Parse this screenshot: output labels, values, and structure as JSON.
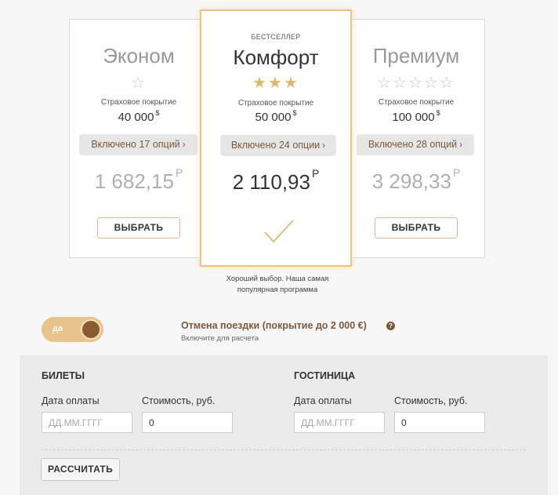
{
  "plans": [
    {
      "name": "Эконом",
      "stars": "☆",
      "coverage_label": "Страховое покрытие",
      "coverage_value": "40 000",
      "coverage_currency": "$",
      "options": "Включено 17 опций",
      "price": "1 682,15",
      "price_currency": "Р",
      "button": "ВЫБРАТЬ",
      "rating": 1,
      "rating_max": 1
    },
    {
      "name": "Комфорт",
      "badge": "БЕСТСЕЛЛЕР",
      "stars": "★★★",
      "coverage_label": "Страховое покрытие",
      "coverage_value": "50 000",
      "coverage_currency": "$",
      "options": "Включено 24 опции",
      "price": "2 110,93",
      "price_currency": "Р",
      "selected": true,
      "rating": 3,
      "rating_max": 3
    },
    {
      "name": "Премиум",
      "stars": "☆☆☆☆☆",
      "coverage_label": "Страховое покрытие",
      "coverage_value": "100 000",
      "coverage_currency": "$",
      "options": "Включено 28 опций",
      "price": "3 298,33",
      "price_currency": "Р",
      "button": "ВЫБРАТЬ",
      "rating": 5,
      "rating_max": 5
    }
  ],
  "hint": {
    "line1": "Хороший выбор. Наша самая",
    "line2": "популярная программа"
  },
  "trip_cancel": {
    "toggle_label": "да",
    "toggle_on": true,
    "title": "Отмена поездки (покрытие до 2 000 €)",
    "help": "?",
    "subtitle": "Включите для расчета"
  },
  "calculator": {
    "tickets": {
      "title": "БИЛЕТЫ",
      "date_label": "Дата оплаты",
      "date_placeholder": "ДД.ММ.ГГГГ",
      "cost_label": "Стоимость, руб.",
      "cost_value": "0"
    },
    "hotel": {
      "title": "ГОСТИНИЦА",
      "date_label": "Дата оплаты",
      "date_placeholder": "ДД.ММ.ГГГГ",
      "cost_label": "Стоимость, руб.",
      "cost_value": "0"
    },
    "button": "РАССЧИТАТЬ"
  },
  "colors": {
    "accent": "#f0c27a",
    "brown": "#7a5a3a",
    "toggle_bg": "#e8c38c",
    "panel_bg": "#ebebeb"
  }
}
